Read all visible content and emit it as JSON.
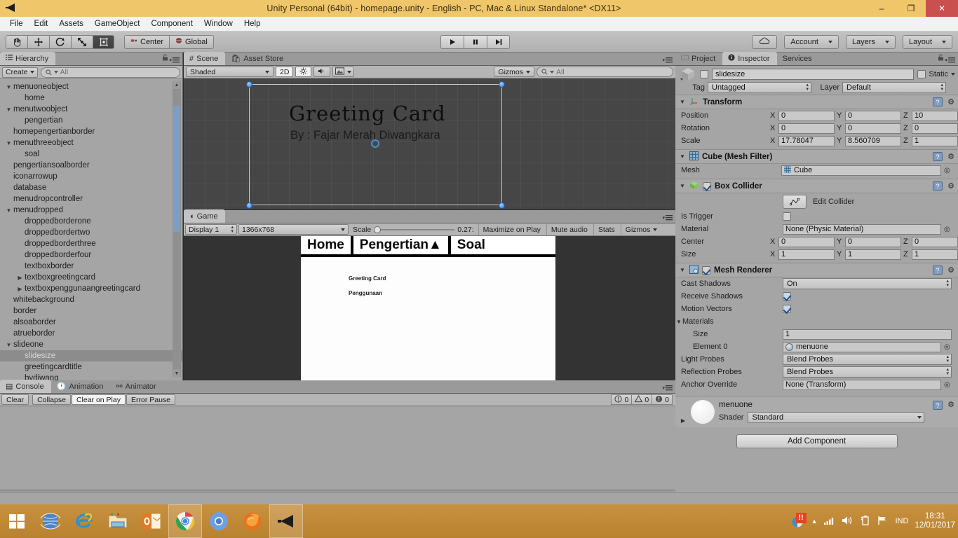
{
  "window": {
    "title": "Unity Personal (64bit) - homepage.unity - English - PC, Mac & Linux Standalone* <DX11>",
    "minimize": "–",
    "maximize": "❐",
    "close": "✕",
    "logo_icon": "unity-logo-icon"
  },
  "menubar": {
    "items": [
      "File",
      "Edit",
      "Assets",
      "GameObject",
      "Component",
      "Window",
      "Help"
    ]
  },
  "toolbar": {
    "tools": [
      {
        "name": "hand-tool",
        "glyph": "✋"
      },
      {
        "name": "move-tool",
        "glyph": "✛"
      },
      {
        "name": "rotate-tool",
        "glyph": "↻"
      },
      {
        "name": "scale-tool",
        "glyph": "⤡"
      },
      {
        "name": "rect-tool",
        "glyph": "▣"
      }
    ],
    "pivot_label": "Center",
    "space_label": "Global",
    "play": "▶",
    "pause": "‖",
    "step": "▶|",
    "cloud_label": "cloud-icon",
    "account_label": "Account",
    "layers_label": "Layers",
    "layout_label": "Layout"
  },
  "hierarchy": {
    "tab": "Hierarchy",
    "create_label": "Create",
    "search_placeholder": "All",
    "items": [
      {
        "label": "menuoneobject",
        "indent": 0,
        "arrow": "down"
      },
      {
        "label": "home",
        "indent": 1,
        "arrow": "none"
      },
      {
        "label": "menutwoobject",
        "indent": 0,
        "arrow": "down"
      },
      {
        "label": "pengertian",
        "indent": 1,
        "arrow": "none"
      },
      {
        "label": "homepengertianborder",
        "indent": 0,
        "arrow": "none"
      },
      {
        "label": "menuthreeobject",
        "indent": 0,
        "arrow": "down"
      },
      {
        "label": "soal",
        "indent": 1,
        "arrow": "none"
      },
      {
        "label": "pengertiansoalborder",
        "indent": 0,
        "arrow": "none"
      },
      {
        "label": "iconarrowup",
        "indent": 0,
        "arrow": "none"
      },
      {
        "label": "database",
        "indent": 0,
        "arrow": "none"
      },
      {
        "label": "menudropcontroller",
        "indent": 0,
        "arrow": "none"
      },
      {
        "label": "menudropped",
        "indent": 0,
        "arrow": "down"
      },
      {
        "label": "droppedborderone",
        "indent": 1,
        "arrow": "none"
      },
      {
        "label": "droppedbordertwo",
        "indent": 1,
        "arrow": "none"
      },
      {
        "label": "droppedborderthree",
        "indent": 1,
        "arrow": "none"
      },
      {
        "label": "droppedborderfour",
        "indent": 1,
        "arrow": "none"
      },
      {
        "label": "textboxborder",
        "indent": 1,
        "arrow": "none"
      },
      {
        "label": "textboxgreetingcard",
        "indent": 1,
        "arrow": "right"
      },
      {
        "label": "textboxpenggunaangreetingcard",
        "indent": 1,
        "arrow": "right"
      },
      {
        "label": "whitebackground",
        "indent": 0,
        "arrow": "none"
      },
      {
        "label": "border",
        "indent": 0,
        "arrow": "none"
      },
      {
        "label": "alsoaborder",
        "indent": 0,
        "arrow": "none"
      },
      {
        "label": "atrueborder",
        "indent": 0,
        "arrow": "none"
      },
      {
        "label": "slideone",
        "indent": 0,
        "arrow": "down"
      },
      {
        "label": "slidesize",
        "indent": 1,
        "arrow": "none",
        "selected": true
      },
      {
        "label": "greetingcardtitle",
        "indent": 1,
        "arrow": "none"
      },
      {
        "label": "bydiwang",
        "indent": 1,
        "arrow": "none"
      }
    ]
  },
  "scene": {
    "tabs": [
      "Scene",
      "Asset Store"
    ],
    "active_tab": "Scene",
    "shading_mode": "Shaded",
    "mode_2d": "2D",
    "lighting_icon": "sun-icon",
    "audio_icon": "speaker-icon",
    "effects_icon": "image-icon",
    "gizmos_label": "Gizmos",
    "search_placeholder": "All",
    "card_title": "Greeting Card",
    "card_subtitle": "By : Fajar Merah Diwangkara"
  },
  "game": {
    "tab": "Game",
    "display": "Display 1",
    "resolution": "1366x768",
    "scale_label": "Scale",
    "scale_value": "0.27:",
    "maximize_on_play": "Maximize on Play",
    "mute_audio": "Mute audio",
    "stats": "Stats",
    "gizmos": "Gizmos",
    "nav_items": [
      "Home",
      "Pengertian▲",
      "Soal"
    ],
    "content_lines": [
      "Greeting Card",
      "Penggunaan"
    ]
  },
  "console": {
    "tabs": [
      "Console",
      "Animation",
      "Animator"
    ],
    "active_tab": "Console",
    "buttons": [
      "Clear",
      "Collapse",
      "Clear on Play",
      "Error Pause"
    ],
    "counts": [
      {
        "icon": "info-icon",
        "value": "0"
      },
      {
        "icon": "warning-icon",
        "value": "0"
      },
      {
        "icon": "error-icon",
        "value": "0"
      }
    ]
  },
  "inspector": {
    "tabs": [
      "Project",
      "Inspector",
      "Services"
    ],
    "active_tab": "Inspector",
    "object_name": "slidesize",
    "static_label": "Static",
    "tag_label": "Tag",
    "tag_value": "Untagged",
    "layer_label": "Layer",
    "layer_value": "Default",
    "components": [
      {
        "name": "Transform",
        "icon": "transform-icon",
        "rows": [
          {
            "label": "Position",
            "type": "vec3",
            "x": "0",
            "y": "0",
            "z": "10"
          },
          {
            "label": "Rotation",
            "type": "vec3",
            "x": "0",
            "y": "0",
            "z": "0"
          },
          {
            "label": "Scale",
            "type": "vec3",
            "x": "17.78047",
            "y": "8.560709",
            "z": "1"
          }
        ]
      },
      {
        "name": "Cube (Mesh Filter)",
        "icon": "mesh-filter-icon",
        "rows": [
          {
            "label": "Mesh",
            "type": "object",
            "value": "Cube"
          }
        ]
      },
      {
        "name": "Box Collider",
        "icon": "box-collider-icon",
        "enabled": true,
        "rows": [
          {
            "label": "",
            "type": "button",
            "value": "Edit Collider"
          },
          {
            "label": "Is Trigger",
            "type": "checkbox",
            "checked": false
          },
          {
            "label": "Material",
            "type": "object",
            "value": "None (Physic Material)"
          },
          {
            "label": "Center",
            "type": "vec3",
            "x": "0",
            "y": "0",
            "z": "0"
          },
          {
            "label": "Size",
            "type": "vec3",
            "x": "1",
            "y": "1",
            "z": "1"
          }
        ]
      },
      {
        "name": "Mesh Renderer",
        "icon": "mesh-renderer-icon",
        "enabled": true,
        "rows": [
          {
            "label": "Cast Shadows",
            "type": "popup",
            "value": "On"
          },
          {
            "label": "Receive Shadows",
            "type": "checkbox",
            "checked": true
          },
          {
            "label": "Motion Vectors",
            "type": "checkbox",
            "checked": true
          },
          {
            "label": "Materials",
            "type": "foldout"
          },
          {
            "label": "Size",
            "type": "text",
            "value": "1",
            "indent": 1
          },
          {
            "label": "Element 0",
            "type": "object",
            "value": "menuone",
            "indent": 1
          },
          {
            "label": "Light Probes",
            "type": "popup",
            "value": "Blend Probes"
          },
          {
            "label": "Reflection Probes",
            "type": "popup",
            "value": "Blend Probes"
          },
          {
            "label": "Anchor Override",
            "type": "object",
            "value": "None (Transform)"
          }
        ]
      }
    ],
    "material": {
      "name": "menuone",
      "shader_label": "Shader",
      "shader_value": "Standard"
    },
    "add_component": "Add Component"
  },
  "taskbar": {
    "start_icon": "windows-start-icon",
    "apps": [
      {
        "name": "internet-globe-icon",
        "open": false
      },
      {
        "name": "internet-explorer-icon",
        "open": false
      },
      {
        "name": "file-explorer-icon",
        "open": false
      },
      {
        "name": "outlook-icon",
        "open": false
      },
      {
        "name": "chrome-icon",
        "open": true
      },
      {
        "name": "chromium-icon",
        "open": false
      },
      {
        "name": "firefox-icon",
        "open": false
      },
      {
        "name": "unity-icon",
        "open": true
      }
    ],
    "tray": {
      "action_center_icon": "action-center-icon",
      "show_hidden_icon": "chevron-up-icon",
      "network_icon": "network-icon",
      "volume_icon": "volume-icon",
      "battery_icon": "battery-icon",
      "flag_icon": "flag-icon",
      "language": "IND",
      "time": "18:31",
      "date": "12/01/2017"
    }
  },
  "colors": {
    "title_bar": "#efc66a",
    "accent_close": "#c9504f",
    "panel_bg": "#a5a5a5",
    "taskbar": "#c0882f"
  }
}
